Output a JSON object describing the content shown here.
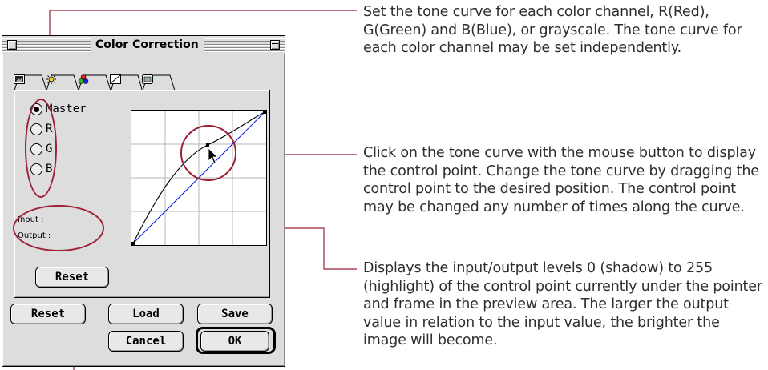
{
  "window": {
    "title": "Color Correction"
  },
  "tabs": [
    {
      "icon": "image-icon"
    },
    {
      "icon": "brightness-icon"
    },
    {
      "icon": "color-balance-icon"
    },
    {
      "icon": "tone-curve-icon"
    },
    {
      "icon": "preview-icon"
    }
  ],
  "channels": {
    "master": "Master",
    "r": "R",
    "g": "G",
    "b": "B",
    "selected": "Master"
  },
  "levels": {
    "input_label": "Input :",
    "output_label": "Output :"
  },
  "buttons": {
    "panel_reset": "Reset",
    "reset": "Reset",
    "load": "Load",
    "save": "Save",
    "cancel": "Cancel",
    "ok": "OK"
  },
  "callouts": {
    "channel": "Set the tone curve for each color channel, R(Red), G(Green) and B(Blue), or grayscale. The tone curve for each color channel may be set independently.",
    "control_point": "Click on the tone curve with the mouse button to display the control point. Change the tone curve by dragging the control point to the desired position. The control point may be changed any number of times along the curve.",
    "levels": "Displays the input/output levels 0 (shadow) to 255 (highlight) of the control point currently under the pointer and frame in the preview area. The larger the output value in relation to the input value, the brighter the image will become."
  },
  "colors": {
    "callout_line": "#9c2036",
    "diagonal": "#1f2ee0",
    "curve": "#000000"
  }
}
